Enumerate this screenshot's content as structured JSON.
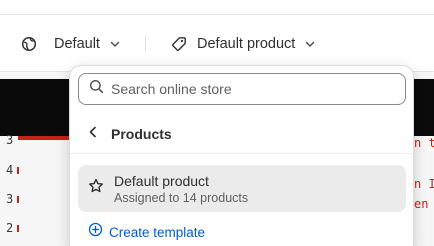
{
  "toolbar": {
    "theme_label": "Default",
    "template_label": "Default product",
    "theme_icon": "globe-icon",
    "template_icon": "tag-icon",
    "chevron_icon": "chevron-down-icon"
  },
  "popover": {
    "search": {
      "placeholder": "Search online store",
      "value": ""
    },
    "back": {
      "label": "Products",
      "icon": "chevron-left-icon"
    },
    "options": [
      {
        "name": "Default product",
        "subtitle": "Assigned to 14 products",
        "icon": "star-icon"
      }
    ],
    "create": {
      "label": "Create template",
      "icon": "plus-circle-icon"
    }
  },
  "background": {
    "counts": [
      "3",
      "4",
      "3",
      "2"
    ],
    "right_text": [
      "n t",
      "n Ip",
      "en"
    ]
  },
  "colors": {
    "accent": "#005bd3",
    "selected_bg": "#ebebeb",
    "error_red": "#c4221a",
    "dark_band": "#0a0a0a"
  }
}
